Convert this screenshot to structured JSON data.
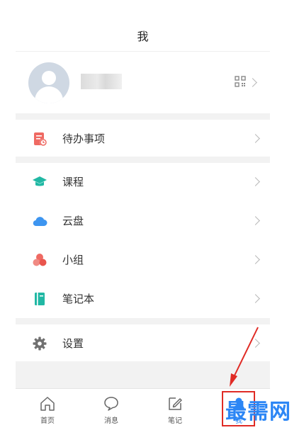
{
  "header": {
    "title": "我"
  },
  "profile": {
    "avatar": "avatar-icon",
    "qr_icon": "qr-code-icon"
  },
  "menu": {
    "todo": {
      "label": "待办事项",
      "icon": "todo-list-icon",
      "color": "#ef6a63"
    },
    "courses": {
      "label": "课程",
      "icon": "graduation-cap-icon",
      "color": "#21b8a4"
    },
    "cloud": {
      "label": "云盘",
      "icon": "cloud-icon",
      "color": "#3d95f0"
    },
    "group": {
      "label": "小组",
      "icon": "group-icon",
      "color": "#ef6a63"
    },
    "notebook": {
      "label": "笔记本",
      "icon": "notebook-icon",
      "color": "#21b8a4"
    },
    "settings": {
      "label": "设置",
      "icon": "gear-icon",
      "color": "#707070"
    }
  },
  "tabs": [
    {
      "label": "首页",
      "icon": "home-icon"
    },
    {
      "label": "消息",
      "icon": "message-icon"
    },
    {
      "label": "笔记",
      "icon": "note-edit-icon"
    },
    {
      "label": "我",
      "icon": "user-icon",
      "active": true
    }
  ],
  "watermark": "最需网",
  "colors": {
    "accent": "#2c86f5",
    "highlight": "#e02b25",
    "gap": "#f2f2f2"
  }
}
